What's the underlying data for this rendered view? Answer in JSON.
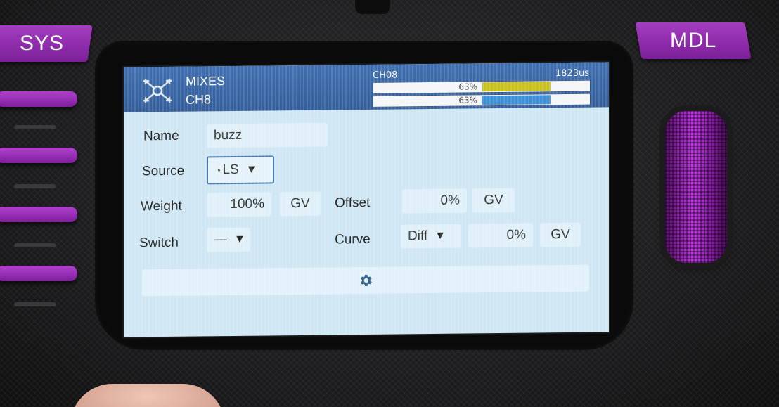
{
  "hardware": {
    "sys_label": "SYS",
    "mdl_label": "MDL"
  },
  "header": {
    "title": "MIXES",
    "subtitle": "CH8",
    "channel_label": "CH08",
    "channel_value": "1823us",
    "bar1_percent": "63%",
    "bar2_percent": "63%",
    "bar1_fill": 0.63,
    "bar2_fill": 0.63,
    "bar1_color": "#c9c21c",
    "bar2_color": "#3d8fd6"
  },
  "form": {
    "name_label": "Name",
    "name_value": "buzz",
    "source_label": "Source",
    "source_value": "LS",
    "weight_label": "Weight",
    "weight_value": "100%",
    "weight_gv": "GV",
    "offset_label": "Offset",
    "offset_value": "0%",
    "offset_gv": "GV",
    "switch_label": "Switch",
    "switch_value": "—",
    "curve_label": "Curve",
    "curve_type": "Diff",
    "curve_value": "0%",
    "curve_gv": "GV"
  },
  "icons": {
    "settings": "gear-icon",
    "source": "logical-switch-icon",
    "dropdown": "chevron-down-icon"
  },
  "colors": {
    "accent": "#8e2aae",
    "header_bg": "#3f6fb0",
    "screen_bg": "#cfe7f4"
  }
}
